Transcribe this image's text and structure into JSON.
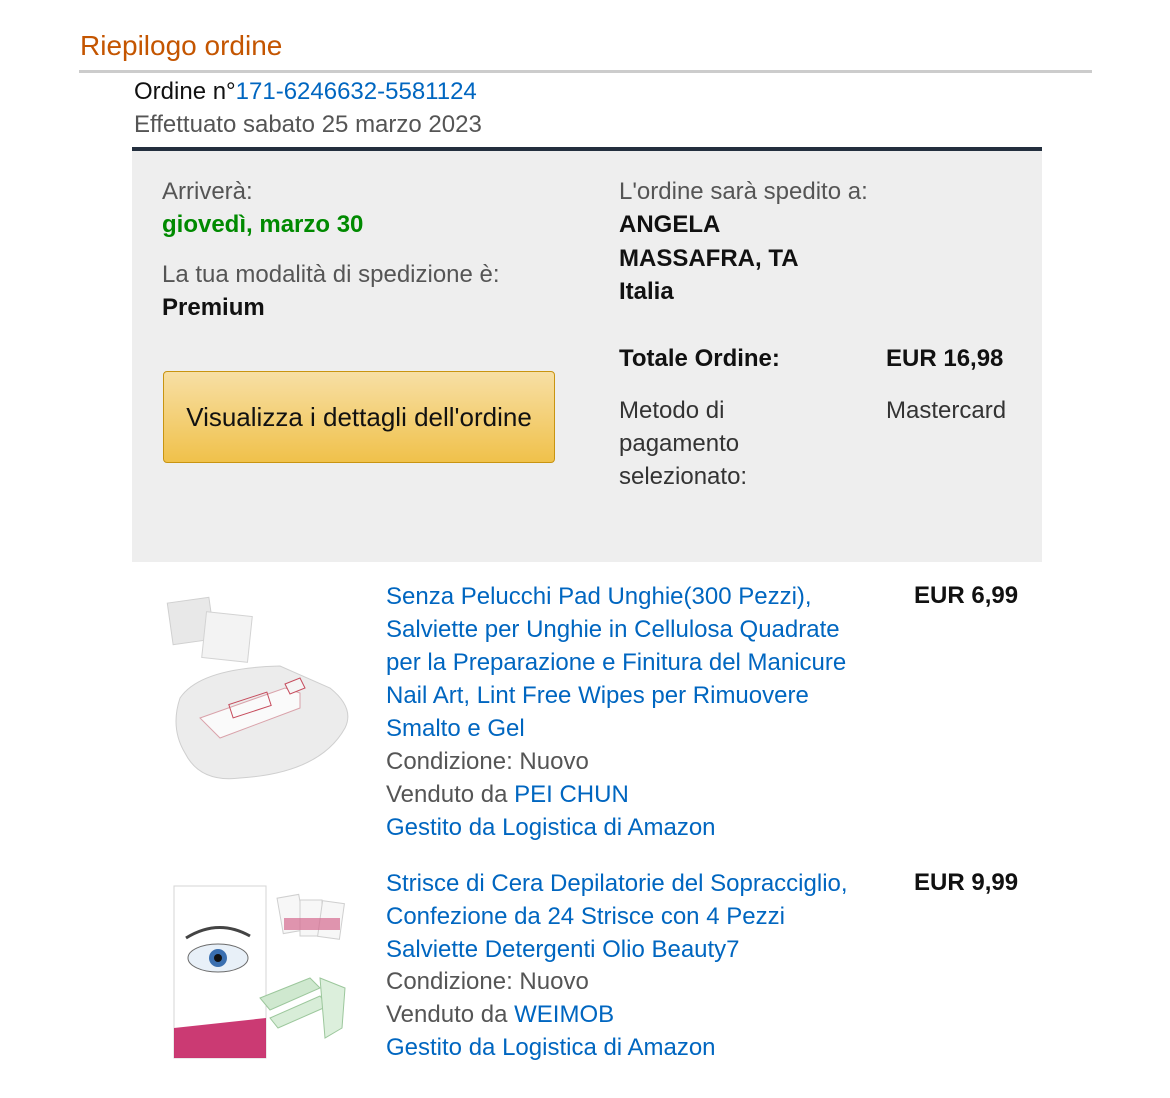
{
  "header": {
    "title": "Riepilogo ordine",
    "order_prefix": "Ordine n°",
    "order_number": "171-6246632-5581124",
    "placed_text": "Effettuato sabato 25 marzo 2023"
  },
  "summary": {
    "arrival_label": "Arriverà:",
    "arrival_date": "giovedì, marzo 30",
    "shipping_mode_label": "La tua modalità di spedizione è:",
    "shipping_mode": "Premium",
    "ship_to_label": "L'ordine sarà spedito a:",
    "ship_to_name": "ANGELA",
    "ship_to_city": "MASSAFRA, TA",
    "ship_to_country": "Italia",
    "total_label": "Totale Ordine:",
    "total_value": "EUR 16,98",
    "payment_label": "Metodo di pagamento selezionato:",
    "payment_value": "Mastercard",
    "details_button": "Visualizza i dettagli dell'ordine"
  },
  "items": [
    {
      "title": "Senza Pelucchi Pad Unghie(300 Pezzi), Salviette per Unghie in Cellulosa Quadrate per la Preparazione e Finitura del Manicure Nail Art, Lint Free Wipes per Rimuovere Smalto e Gel",
      "title_lines": [
        "Senza Pelucchi Pad Unghie(300 Pezzi),",
        "Salviette per Unghie in Cellulosa Quadrate",
        "per la Preparazione e Finitura del Manicure",
        "Nail Art, Lint Free Wipes per Rimuovere",
        "Smalto e Gel"
      ],
      "condition": "Condizione: Nuovo",
      "sold_by_prefix": "Venduto da ",
      "seller": "PEI CHUN",
      "fulfilled": "Gestito da Logistica di Amazon",
      "price": "EUR 6,99"
    },
    {
      "title": "Strisce di Cera Depilatorie del Sopracciglio, Confezione da 24 Strisce con 4 Pezzi Salviette Detergenti Olio Beauty7",
      "title_lines": [
        "Strisce di Cera Depilatorie del Sopracciglio,",
        "Confezione da 24 Strisce con 4 Pezzi",
        "Salviette Detergenti Olio Beauty7"
      ],
      "condition": "Condizione: Nuovo",
      "sold_by_prefix": "Venduto da ",
      "seller": "WEIMOB",
      "fulfilled": "Gestito da Logistica di Amazon",
      "price": "EUR 9,99"
    }
  ]
}
